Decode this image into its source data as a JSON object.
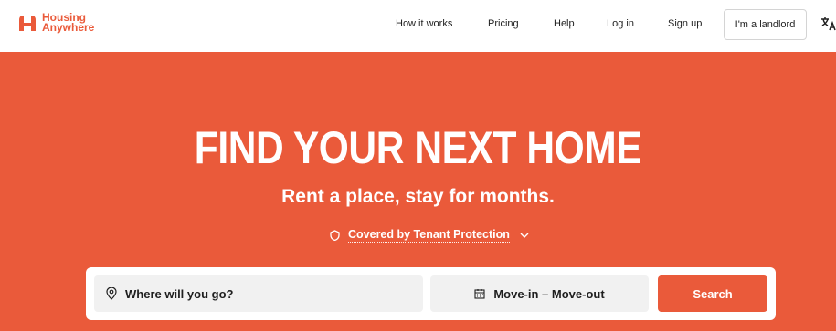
{
  "brand": {
    "line1": "Housing",
    "line2": "Anywhere",
    "color": "#ea5a3a"
  },
  "nav": {
    "how_it_works": "How it works",
    "pricing": "Pricing",
    "help": "Help",
    "login": "Log in",
    "signup": "Sign up",
    "landlord": "I'm a landlord",
    "language_icon": "translate-icon"
  },
  "hero": {
    "title": "FIND YOUR NEXT HOME",
    "subtitle": "Rent a place, stay for months.",
    "protection_label": "Covered by Tenant Protection",
    "background": "#ea5a3a"
  },
  "search": {
    "where_placeholder": "Where will you go?",
    "dates_label": "Move-in – Move-out",
    "button_label": "Search"
  }
}
